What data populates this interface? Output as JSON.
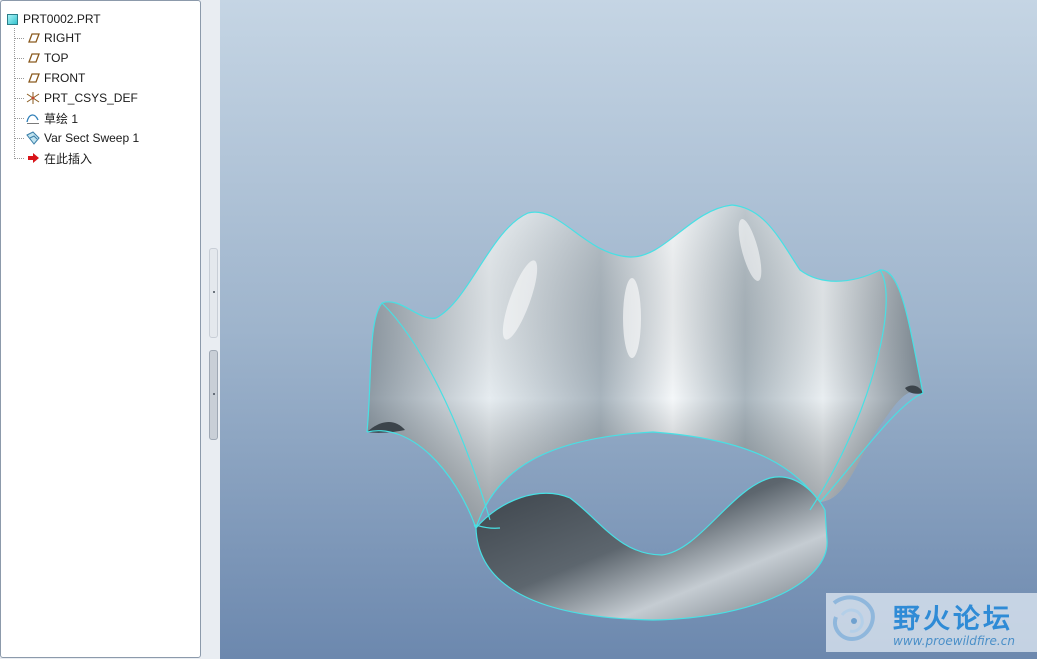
{
  "model_tree": {
    "root": {
      "label": "PRT0002.PRT",
      "icon": "part-icon"
    },
    "items": [
      {
        "label": "RIGHT",
        "icon": "datum-plane-icon"
      },
      {
        "label": "TOP",
        "icon": "datum-plane-icon"
      },
      {
        "label": "FRONT",
        "icon": "datum-plane-icon"
      },
      {
        "label": "PRT_CSYS_DEF",
        "icon": "coordinate-system-icon"
      },
      {
        "label": "草绘 1",
        "icon": "sketch-icon"
      },
      {
        "label": "Var Sect Sweep 1",
        "icon": "sweep-feature-icon"
      },
      {
        "label": "在此插入",
        "icon": "insert-here-arrow-icon"
      }
    ]
  },
  "viewport": {
    "background_top": "#c5d5e4",
    "background_bottom": "#6c88ae",
    "model": "var-sect-sweep-surface",
    "edge_color": "#48e0e4",
    "surface_color": "#c9d3da"
  },
  "watermark": {
    "title": "野火论坛",
    "url": "www.proewildfire.cn"
  }
}
